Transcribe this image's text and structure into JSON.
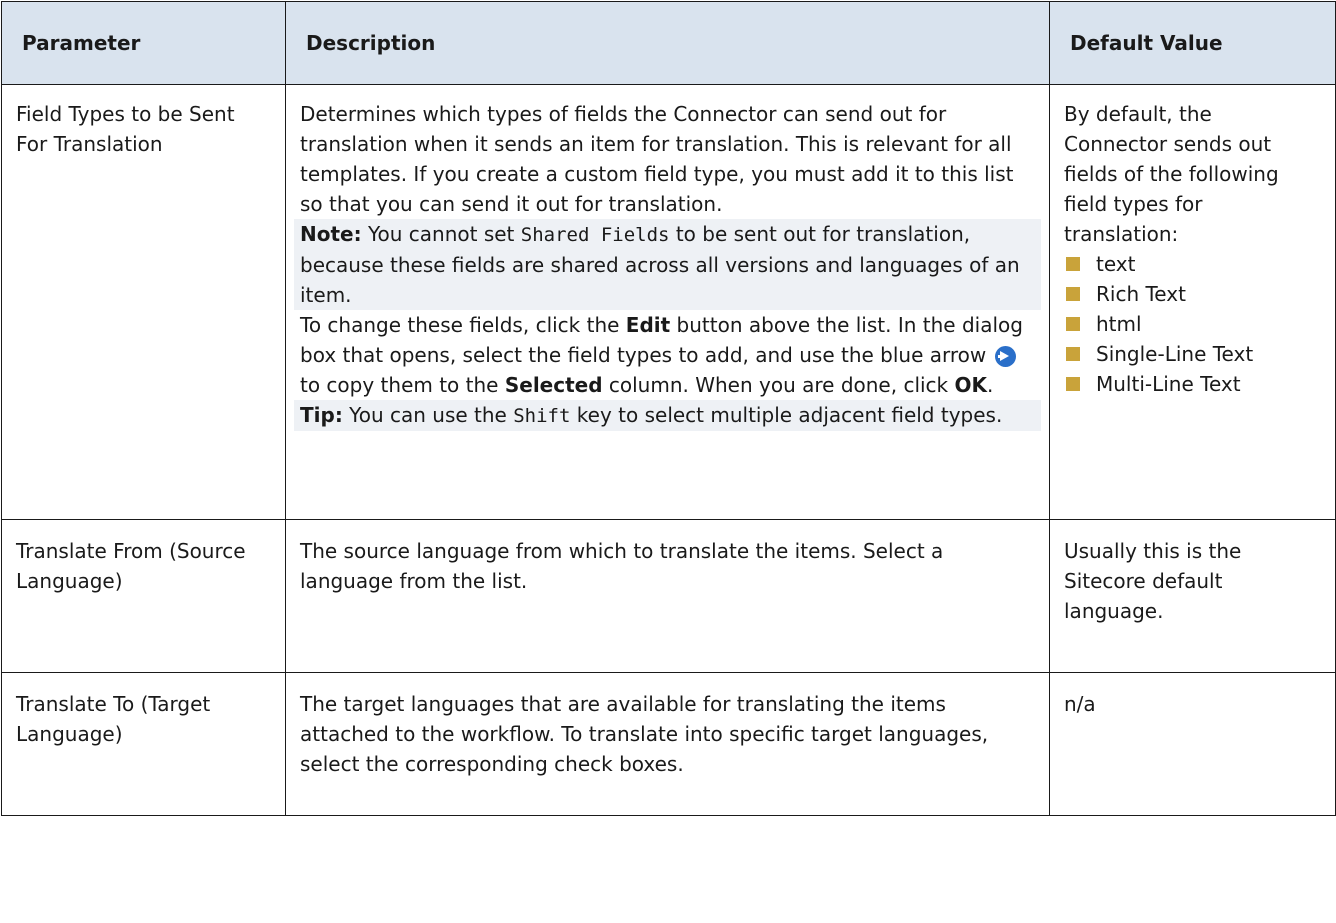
{
  "headers": {
    "parameter": "Parameter",
    "description": "Description",
    "default": "Default Value"
  },
  "rows": [
    {
      "parameter": "Field Types to be Sent For Translation",
      "desc_intro": "Determines which types of fields the Connector can send out for translation when it sends an item for translation. This is relevant for all templates. If you create a custom field type, you must add it to this list so that you can send it out for translation.",
      "note_label": "Note:",
      "note_pre": " You cannot set ",
      "note_code": "Shared Fields",
      "note_post": " to be sent out for translation, because these fields are shared across all versions and languages of an item.",
      "change_pre": "To change these fields, click the ",
      "change_edit": "Edit",
      "change_mid": " button above the list. In the dialog box that opens, select the field types to add, and use the blue arrow ",
      "change_mid2": " to copy them to the ",
      "change_selected": "Selected",
      "change_mid3": " column. When you are done, click ",
      "change_ok": "OK",
      "change_end": ".",
      "tip_label": "Tip:",
      "tip_pre": " You can use the ",
      "tip_code": "Shift",
      "tip_post": " key to select multiple adjacent field types.",
      "default_intro": "By default, the Connector sends out fields of the following field types for translation:",
      "default_types": [
        "text",
        "Rich Text",
        "html",
        "Single-Line Text",
        "Multi-Line Text"
      ]
    },
    {
      "parameter": "Translate From (Source Language)",
      "description": "The source language from which to translate the items. Select a language from the list.",
      "default": "Usually this is the Sitecore default language."
    },
    {
      "parameter": "Translate To (Target Language)",
      "description": "The target languages that are available for translating the items attached to the workflow. To translate into specific target languages, select the corresponding check boxes.",
      "default": "n/a"
    }
  ],
  "colors": {
    "header_bg": "#d9e3ee",
    "note_bg": "#eef1f5",
    "bullet": "#c9a33a",
    "arrow": "#2a6fc9"
  },
  "icons": {
    "arrow": "blue-right-arrow-icon",
    "bullet": "square-bullet-icon"
  }
}
